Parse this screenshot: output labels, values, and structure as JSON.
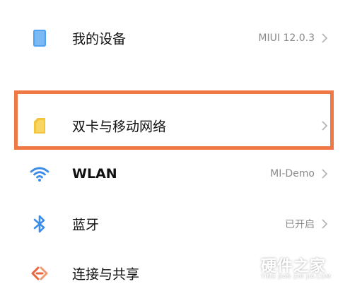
{
  "settings": {
    "items": [
      {
        "label": "我的设备",
        "value": "MIUI 12.0.3",
        "icon": "tablet-icon"
      },
      {
        "label": "双卡与移动网络",
        "value": "",
        "icon": "sim-card-icon"
      },
      {
        "label": "WLAN",
        "value": "MI-Demo",
        "icon": "wifi-icon"
      },
      {
        "label": "蓝牙",
        "value": "已开启",
        "icon": "bluetooth-icon"
      },
      {
        "label": "连接与共享",
        "value": "",
        "icon": "connection-share-icon"
      }
    ]
  },
  "highlight": {
    "color": "#f07844"
  },
  "watermark": {
    "title": "硬件之家",
    "subtitle": "YING JIAN ZHI JIA.COM"
  },
  "colors": {
    "accent_blue": "#3d8de8",
    "sim_yellow": "#f3c53a",
    "share_orange": "#e8673f",
    "chevron": "#b0b0b0"
  }
}
